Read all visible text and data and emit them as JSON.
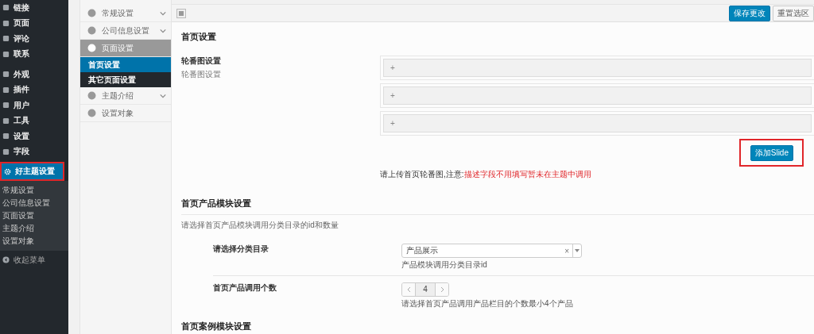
{
  "admin_menu": {
    "items": [
      {
        "label": "链接",
        "selected": false
      },
      {
        "label": "页面",
        "selected": false
      },
      {
        "label": "评论",
        "selected": false
      },
      {
        "label": "联系",
        "selected": false
      },
      {
        "label": "外观",
        "selected": false
      },
      {
        "label": "插件",
        "selected": false
      },
      {
        "label": "用户",
        "selected": false
      },
      {
        "label": "工具",
        "selected": false
      },
      {
        "label": "设置",
        "selected": false
      },
      {
        "label": "字段",
        "selected": false
      },
      {
        "label": "好主题设置",
        "selected": true
      }
    ],
    "submenu": [
      "常规设置",
      "公司信息设置",
      "页面设置",
      "主题介绍",
      "设置对象"
    ],
    "collapse": "收起菜单"
  },
  "options_nav": [
    {
      "label": "常规设置",
      "kind": "group",
      "expanded": false
    },
    {
      "label": "公司信息设置",
      "kind": "group",
      "expanded": false
    },
    {
      "label": "页面设置",
      "kind": "group",
      "expanded": true,
      "children": [
        {
          "label": "首页设置",
          "selected": true
        },
        {
          "label": "其它页面设置",
          "selected": false
        }
      ]
    },
    {
      "label": "主题介绍",
      "kind": "group",
      "expanded": false
    },
    {
      "label": "设置对象",
      "kind": "link",
      "expanded": false
    }
  ],
  "toolbar": {
    "buttons": [
      {
        "label": "保存更改",
        "kind": "primary"
      },
      {
        "label": "重置选区",
        "kind": "secondary"
      }
    ]
  },
  "sections": [
    {
      "title": "首页设置",
      "fields": [
        {
          "kind": "slides",
          "label": "轮番图设置",
          "sublabel": "轮番图设置",
          "slides": [
            "+",
            "+",
            "+"
          ],
          "add_button": "添加Slide",
          "note": "请上传首页轮番图,注意:",
          "warning": "描述字段不用填写暂未在主题中调用"
        }
      ]
    },
    {
      "title": "首页产品模块设置",
      "description": "请选择首页产品模块调用分类目录的id和数量",
      "fields": [
        {
          "kind": "select",
          "label": "请选择分类目录",
          "value": "产品展示",
          "clear": "×",
          "description": "产品模块调用分类目录id"
        },
        {
          "kind": "stepper",
          "label": "首页产品调用个数",
          "value": "4",
          "description": "请选择首页产品调用产品栏目的个数最小4个产品"
        }
      ]
    },
    {
      "title": "首页案例模块设置"
    }
  ]
}
